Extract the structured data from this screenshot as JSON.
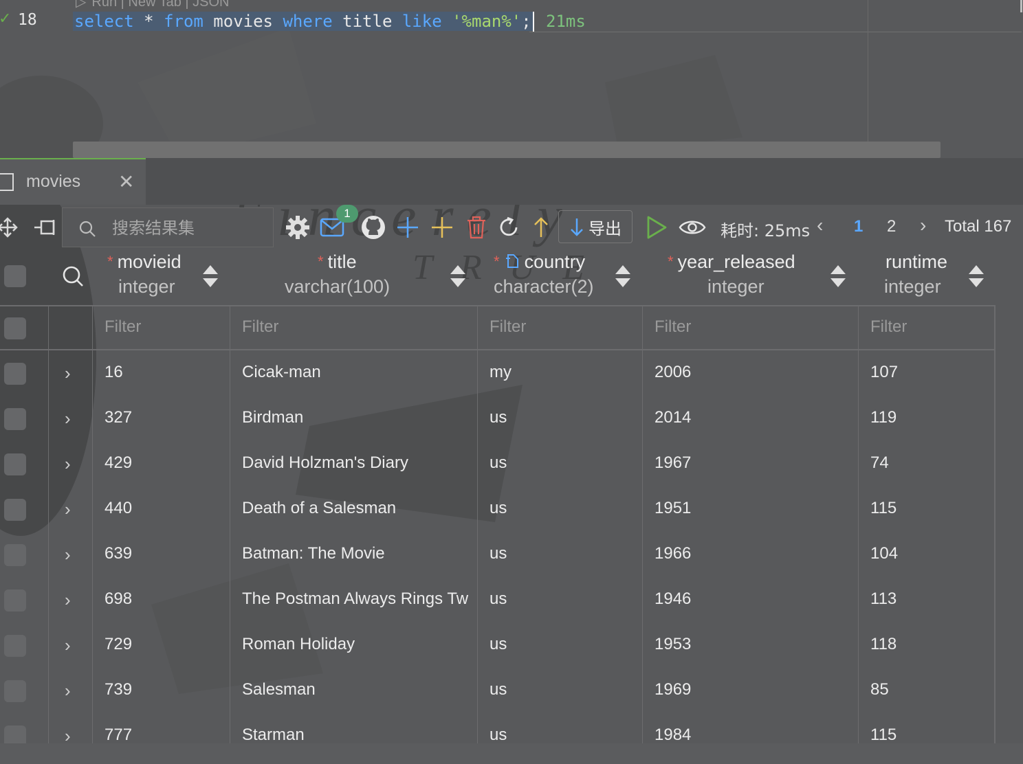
{
  "editor": {
    "codelens": "Run | New Tab | JSON",
    "line_number": "18",
    "tokens": {
      "select": "select",
      "star": " * ",
      "from": "from",
      "table": " movies ",
      "where": "where",
      "column": " title ",
      "like": "like",
      "literal": " '%man%'",
      "semicolon": ";"
    },
    "exec_time": "21ms"
  },
  "tab": {
    "label": "movies",
    "close": "✕"
  },
  "toolbar": {
    "search_placeholder": "搜索结果集",
    "notification_count": "1",
    "export_label": "导出",
    "timing": "耗时: 25ms",
    "pages": [
      "1",
      "2"
    ],
    "total": "Total 167",
    "icons": [
      "move-icon",
      "pin-icon",
      "search-icon",
      "gear-icon",
      "mail-icon",
      "github-icon",
      "add-row-icon",
      "add-column-icon",
      "delete-icon",
      "refresh-icon",
      "upload-icon",
      "download-icon",
      "run-icon",
      "preview-icon"
    ],
    "colors": {
      "add": "#5aa8ff",
      "add_alt": "#e6c15a",
      "delete": "#e0625a",
      "upload": "#e6c15a",
      "run": "#6ab04c",
      "accent": "#5aa8ff"
    }
  },
  "columns": [
    {
      "name": "movieid",
      "type": "integer",
      "required": "*"
    },
    {
      "name": "title",
      "type": "varchar(100)",
      "required": "*"
    },
    {
      "name": "country",
      "type": "character(2)",
      "required": "*"
    },
    {
      "name": "year_released",
      "type": "integer",
      "required": "*"
    },
    {
      "name": "runtime",
      "type": "integer",
      "required": ""
    }
  ],
  "filter_placeholder": "Filter",
  "rows": [
    [
      "16",
      "Cicak-man",
      "my",
      "2006",
      "107"
    ],
    [
      "327",
      "Birdman",
      "us",
      "2014",
      "119"
    ],
    [
      "429",
      "David Holzman's Diary",
      "us",
      "1967",
      "74"
    ],
    [
      "440",
      "Death of a Salesman",
      "us",
      "1951",
      "115"
    ],
    [
      "639",
      "Batman: The Movie",
      "us",
      "1966",
      "104"
    ],
    [
      "698",
      "The Postman Always Rings Tw",
      "us",
      "1946",
      "113"
    ],
    [
      "729",
      "Roman Holiday",
      "us",
      "1953",
      "118"
    ],
    [
      "739",
      "Salesman",
      "us",
      "1969",
      "85"
    ],
    [
      "777",
      "Starman",
      "us",
      "1984",
      "115"
    ]
  ],
  "watermark": {
    "line1": "Sincerely",
    "line2": "TRUE"
  }
}
